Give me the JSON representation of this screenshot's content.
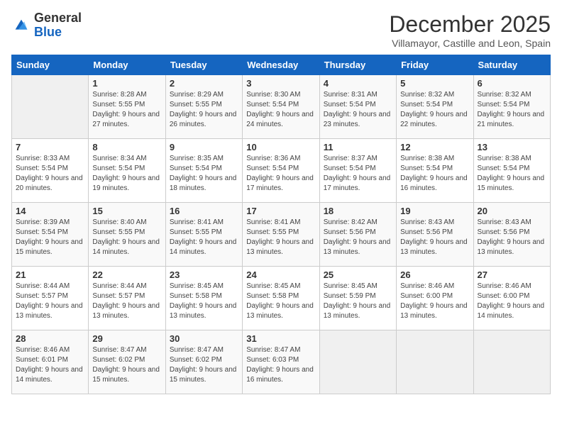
{
  "header": {
    "logo_general": "General",
    "logo_blue": "Blue",
    "month_title": "December 2025",
    "subtitle": "Villamayor, Castille and Leon, Spain"
  },
  "days_of_week": [
    "Sunday",
    "Monday",
    "Tuesday",
    "Wednesday",
    "Thursday",
    "Friday",
    "Saturday"
  ],
  "weeks": [
    [
      {
        "day": "",
        "sunrise": "",
        "sunset": "",
        "daylight": ""
      },
      {
        "day": "1",
        "sunrise": "Sunrise: 8:28 AM",
        "sunset": "Sunset: 5:55 PM",
        "daylight": "Daylight: 9 hours and 27 minutes."
      },
      {
        "day": "2",
        "sunrise": "Sunrise: 8:29 AM",
        "sunset": "Sunset: 5:55 PM",
        "daylight": "Daylight: 9 hours and 26 minutes."
      },
      {
        "day": "3",
        "sunrise": "Sunrise: 8:30 AM",
        "sunset": "Sunset: 5:54 PM",
        "daylight": "Daylight: 9 hours and 24 minutes."
      },
      {
        "day": "4",
        "sunrise": "Sunrise: 8:31 AM",
        "sunset": "Sunset: 5:54 PM",
        "daylight": "Daylight: 9 hours and 23 minutes."
      },
      {
        "day": "5",
        "sunrise": "Sunrise: 8:32 AM",
        "sunset": "Sunset: 5:54 PM",
        "daylight": "Daylight: 9 hours and 22 minutes."
      },
      {
        "day": "6",
        "sunrise": "Sunrise: 8:32 AM",
        "sunset": "Sunset: 5:54 PM",
        "daylight": "Daylight: 9 hours and 21 minutes."
      }
    ],
    [
      {
        "day": "7",
        "sunrise": "Sunrise: 8:33 AM",
        "sunset": "Sunset: 5:54 PM",
        "daylight": "Daylight: 9 hours and 20 minutes."
      },
      {
        "day": "8",
        "sunrise": "Sunrise: 8:34 AM",
        "sunset": "Sunset: 5:54 PM",
        "daylight": "Daylight: 9 hours and 19 minutes."
      },
      {
        "day": "9",
        "sunrise": "Sunrise: 8:35 AM",
        "sunset": "Sunset: 5:54 PM",
        "daylight": "Daylight: 9 hours and 18 minutes."
      },
      {
        "day": "10",
        "sunrise": "Sunrise: 8:36 AM",
        "sunset": "Sunset: 5:54 PM",
        "daylight": "Daylight: 9 hours and 17 minutes."
      },
      {
        "day": "11",
        "sunrise": "Sunrise: 8:37 AM",
        "sunset": "Sunset: 5:54 PM",
        "daylight": "Daylight: 9 hours and 17 minutes."
      },
      {
        "day": "12",
        "sunrise": "Sunrise: 8:38 AM",
        "sunset": "Sunset: 5:54 PM",
        "daylight": "Daylight: 9 hours and 16 minutes."
      },
      {
        "day": "13",
        "sunrise": "Sunrise: 8:38 AM",
        "sunset": "Sunset: 5:54 PM",
        "daylight": "Daylight: 9 hours and 15 minutes."
      }
    ],
    [
      {
        "day": "14",
        "sunrise": "Sunrise: 8:39 AM",
        "sunset": "Sunset: 5:54 PM",
        "daylight": "Daylight: 9 hours and 15 minutes."
      },
      {
        "day": "15",
        "sunrise": "Sunrise: 8:40 AM",
        "sunset": "Sunset: 5:55 PM",
        "daylight": "Daylight: 9 hours and 14 minutes."
      },
      {
        "day": "16",
        "sunrise": "Sunrise: 8:41 AM",
        "sunset": "Sunset: 5:55 PM",
        "daylight": "Daylight: 9 hours and 14 minutes."
      },
      {
        "day": "17",
        "sunrise": "Sunrise: 8:41 AM",
        "sunset": "Sunset: 5:55 PM",
        "daylight": "Daylight: 9 hours and 13 minutes."
      },
      {
        "day": "18",
        "sunrise": "Sunrise: 8:42 AM",
        "sunset": "Sunset: 5:56 PM",
        "daylight": "Daylight: 9 hours and 13 minutes."
      },
      {
        "day": "19",
        "sunrise": "Sunrise: 8:43 AM",
        "sunset": "Sunset: 5:56 PM",
        "daylight": "Daylight: 9 hours and 13 minutes."
      },
      {
        "day": "20",
        "sunrise": "Sunrise: 8:43 AM",
        "sunset": "Sunset: 5:56 PM",
        "daylight": "Daylight: 9 hours and 13 minutes."
      }
    ],
    [
      {
        "day": "21",
        "sunrise": "Sunrise: 8:44 AM",
        "sunset": "Sunset: 5:57 PM",
        "daylight": "Daylight: 9 hours and 13 minutes."
      },
      {
        "day": "22",
        "sunrise": "Sunrise: 8:44 AM",
        "sunset": "Sunset: 5:57 PM",
        "daylight": "Daylight: 9 hours and 13 minutes."
      },
      {
        "day": "23",
        "sunrise": "Sunrise: 8:45 AM",
        "sunset": "Sunset: 5:58 PM",
        "daylight": "Daylight: 9 hours and 13 minutes."
      },
      {
        "day": "24",
        "sunrise": "Sunrise: 8:45 AM",
        "sunset": "Sunset: 5:58 PM",
        "daylight": "Daylight: 9 hours and 13 minutes."
      },
      {
        "day": "25",
        "sunrise": "Sunrise: 8:45 AM",
        "sunset": "Sunset: 5:59 PM",
        "daylight": "Daylight: 9 hours and 13 minutes."
      },
      {
        "day": "26",
        "sunrise": "Sunrise: 8:46 AM",
        "sunset": "Sunset: 6:00 PM",
        "daylight": "Daylight: 9 hours and 13 minutes."
      },
      {
        "day": "27",
        "sunrise": "Sunrise: 8:46 AM",
        "sunset": "Sunset: 6:00 PM",
        "daylight": "Daylight: 9 hours and 14 minutes."
      }
    ],
    [
      {
        "day": "28",
        "sunrise": "Sunrise: 8:46 AM",
        "sunset": "Sunset: 6:01 PM",
        "daylight": "Daylight: 9 hours and 14 minutes."
      },
      {
        "day": "29",
        "sunrise": "Sunrise: 8:47 AM",
        "sunset": "Sunset: 6:02 PM",
        "daylight": "Daylight: 9 hours and 15 minutes."
      },
      {
        "day": "30",
        "sunrise": "Sunrise: 8:47 AM",
        "sunset": "Sunset: 6:02 PM",
        "daylight": "Daylight: 9 hours and 15 minutes."
      },
      {
        "day": "31",
        "sunrise": "Sunrise: 8:47 AM",
        "sunset": "Sunset: 6:03 PM",
        "daylight": "Daylight: 9 hours and 16 minutes."
      },
      {
        "day": "",
        "sunrise": "",
        "sunset": "",
        "daylight": ""
      },
      {
        "day": "",
        "sunrise": "",
        "sunset": "",
        "daylight": ""
      },
      {
        "day": "",
        "sunrise": "",
        "sunset": "",
        "daylight": ""
      }
    ]
  ]
}
